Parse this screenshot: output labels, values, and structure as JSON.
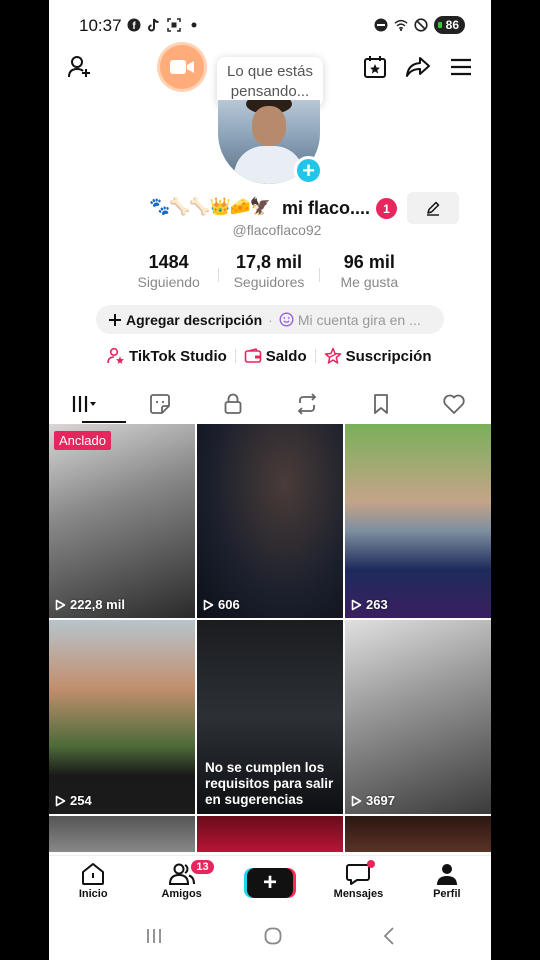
{
  "status": {
    "time": "10:37",
    "battery": "86"
  },
  "header": {
    "tooltip_line1": "Lo que estás",
    "tooltip_line2": "pensando..."
  },
  "profile": {
    "emojis": "🐾🦴🦴👑🧀🦅",
    "name": "mi flaco....",
    "notification_count": "1",
    "handle": "@flacoflaco92"
  },
  "stats": [
    {
      "value": "1484",
      "label": "Siguiendo"
    },
    {
      "value": "17,8 mil",
      "label": "Seguidores"
    },
    {
      "value": "96 mil",
      "label": "Me gusta"
    }
  ],
  "description": {
    "add_label": "Agregar descripción",
    "hint": "Mi cuenta gira en ..."
  },
  "links": {
    "studio": "TikTok Studio",
    "balance": "Saldo",
    "subscription": "Suscripción"
  },
  "videos": [
    {
      "views": "222,8 mil",
      "pinned": "Anclado"
    },
    {
      "views": "606"
    },
    {
      "views": "263"
    },
    {
      "views": "254"
    },
    {
      "notice": "No se cumplen los requisitos para salir en sugerencias"
    },
    {
      "views": "3697"
    }
  ],
  "nav": {
    "home": "Inicio",
    "friends": "Amigos",
    "friends_badge": "13",
    "messages": "Mensajes",
    "profile": "Perfil"
  },
  "colors": {
    "accent": "#e8265e",
    "cyan": "#20c5e8",
    "live": "#ffab7a"
  }
}
